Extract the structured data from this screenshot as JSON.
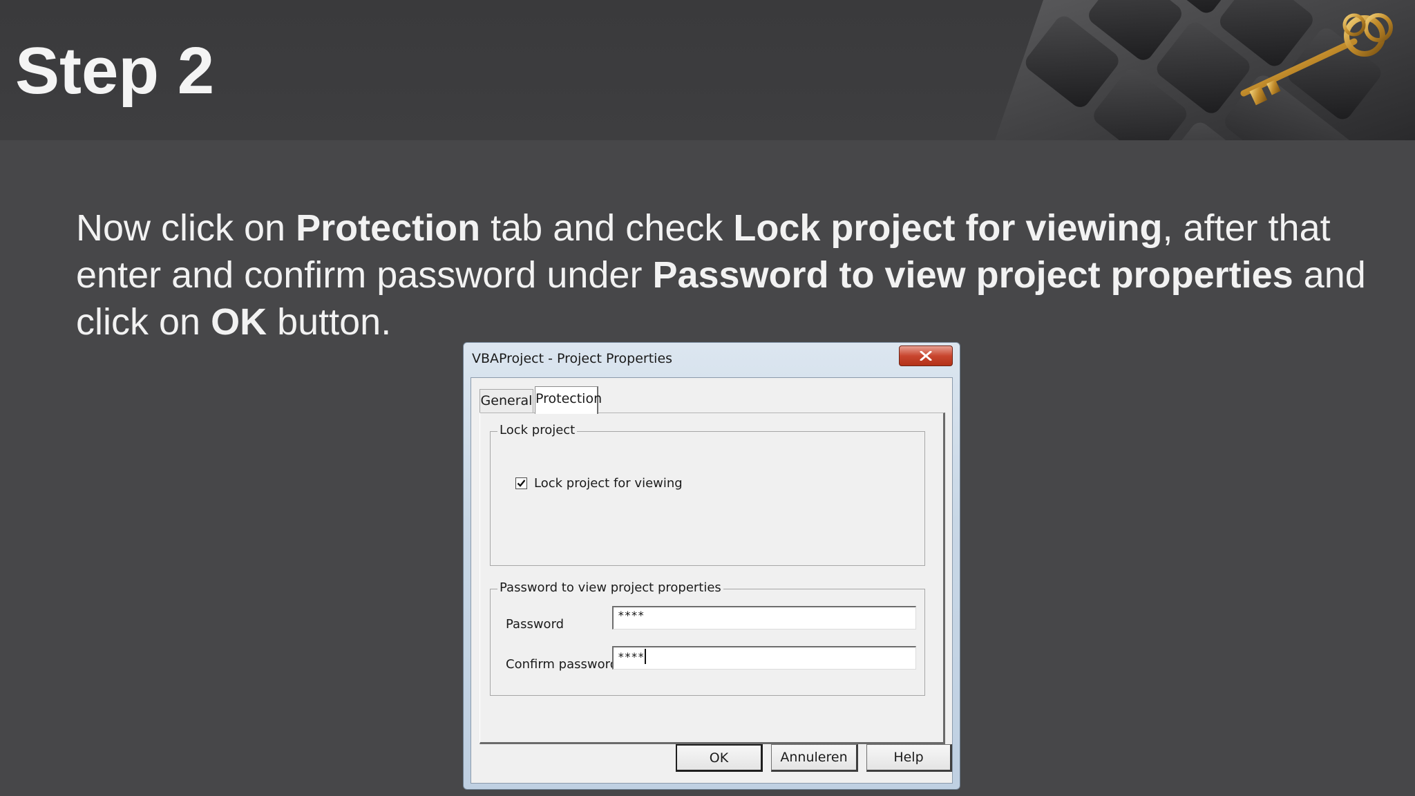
{
  "slide": {
    "title": "Step 2",
    "instruction": [
      {
        "text": "Now click on ",
        "bold": false
      },
      {
        "text": "Protection",
        "bold": true
      },
      {
        "text": " tab and check ",
        "bold": false
      },
      {
        "text": "Lock project for viewing",
        "bold": true
      },
      {
        "text": ", after that enter and confirm password under ",
        "bold": false
      },
      {
        "text": "Password to view project properties",
        "bold": true
      },
      {
        "text": " and click on ",
        "bold": false
      },
      {
        "text": "OK",
        "bold": true
      },
      {
        "text": " button.",
        "bold": false
      }
    ],
    "header_image": "keyboard-with-golden-key"
  },
  "dialog": {
    "title": "VBAProject - Project Properties",
    "close_icon": "close-icon",
    "tabs": [
      {
        "label": "General",
        "selected": false
      },
      {
        "label": "Protection",
        "selected": true
      }
    ],
    "lock_group": {
      "legend": "Lock project",
      "checkbox_label": "Lock project for viewing",
      "checked": true
    },
    "password_group": {
      "legend": "Password to view project properties",
      "password_label": "Password",
      "password_value": "****",
      "confirm_label": "Confirm password",
      "confirm_value": "****"
    },
    "buttons": {
      "ok": "OK",
      "cancel": "Annuleren",
      "help": "Help"
    }
  },
  "colors": {
    "background": "#474749",
    "header": "#3a3a3c",
    "close_button": "#c8462f"
  }
}
